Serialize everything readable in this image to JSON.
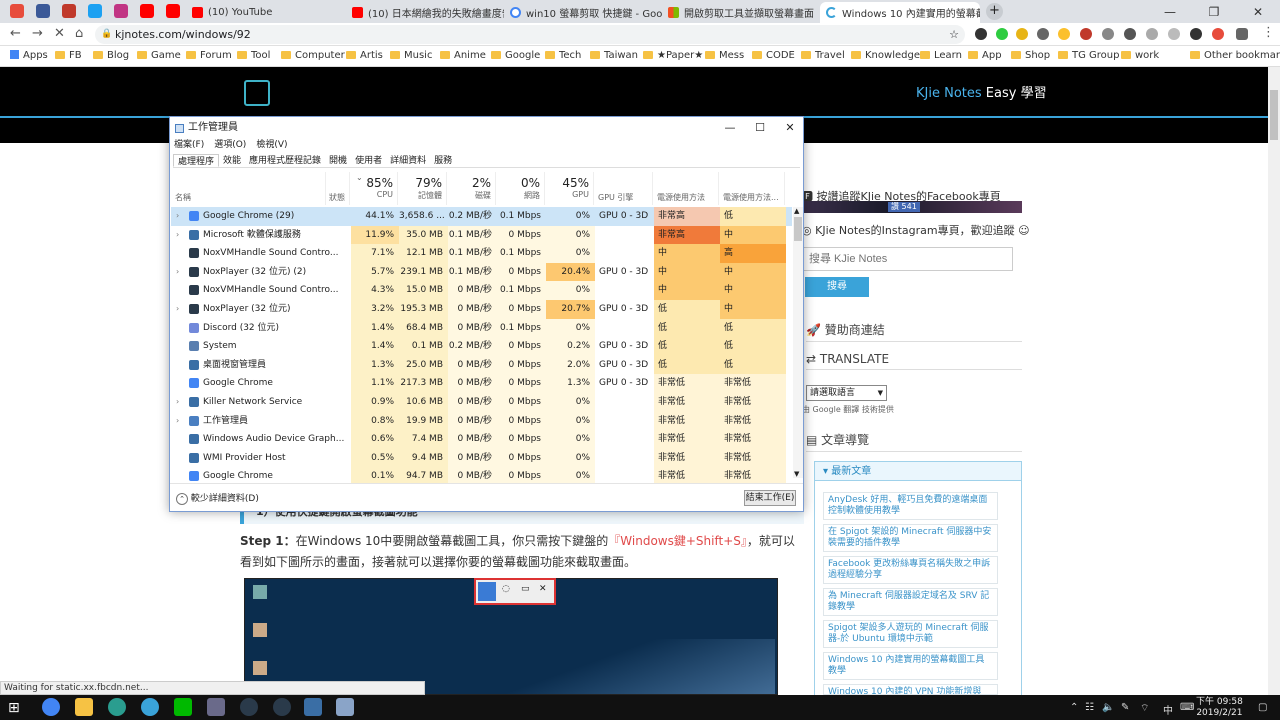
{
  "browser": {
    "tabs": [
      {
        "title": "(10) YouTube",
        "color": "#ff0000"
      },
      {
        "title": "(10) 日本網繪我的失敗繪畫度告訴...",
        "color": "#ff0000"
      },
      {
        "title": "win10 螢幕剪取 快捷鍵 - Google...",
        "color": "#4285f4"
      },
      {
        "title": "開啟剪取工具並擷取螢幕畫面",
        "color": "#f4b400"
      },
      {
        "title": "Windows 10 內建實用的螢幕截...",
        "color": "#3aa3d9"
      }
    ],
    "url": "kjnotes.com/windows/92",
    "bookmarks": [
      "Apps",
      "FB",
      "Blog",
      "Game",
      "Forum",
      "Tool",
      "Computer",
      "Artis",
      "Music",
      "Anime",
      "Google",
      "Tech",
      "Taiwan",
      "★Paper★",
      "Mess",
      "CODE",
      "Travel",
      "Knowledge",
      "Learn",
      "App",
      "Shop",
      "TG Group",
      "work",
      "Other bookmarks"
    ]
  },
  "site": {
    "title": "KJie Notes",
    "subtitle": "Easy 學習"
  },
  "article": {
    "heading": "1）使用快捷鍵開啟螢幕截圖功能",
    "step_label": "Step 1：",
    "step_text_a": "在Windows 10中要開啟螢幕截圖工具，你只需按下鍵盤的",
    "step_keys": "『Windows鍵+Shift+S』",
    "step_text_b": "，就可以看到如下圖所示的畫面，接著就可以選擇你要的螢幕截圖功能來截取畫面。"
  },
  "sidebar": {
    "fb_text": "按讚追蹤KJie Notes的Facebook專頁",
    "like_label": "讚 541",
    "ig_text": "KJie Notes的Instagram專頁，歡迎追蹤 ☺",
    "search_placeholder": "搜尋 KJie Notes",
    "search_button": "搜尋",
    "sponsor": "贊助商連結",
    "translate": "TRANSLATE",
    "lang_select": "請選取語言",
    "powered": "由 Google 翻譯 技術提供",
    "nav": "文章導覽",
    "latest": "最新文章",
    "posts": [
      "AnyDesk 好用、輕巧且免費的遠端桌面控制軟體使用教學",
      "在 Spigot 架設的 Minecraft 伺服器中安裝需要的插件教學",
      "Facebook 更改粉絲專頁名稱失敗之申訴過程經驗分享",
      "為 Minecraft 伺服器設定域名及 SRV 記錄教學",
      "Spigot 架設多人遊玩的 Minecraft 伺服器-於 Ubuntu 環境中示範",
      "Windows 10 內建實用的螢幕截圖工具教學",
      "Windows 10 內建的 VPN 功能新增與設..."
    ]
  },
  "taskmgr": {
    "title": "工作管理員",
    "menu": [
      "檔案(F)",
      "選項(O)",
      "檢視(V)"
    ],
    "tabs": [
      "處理程序",
      "效能",
      "應用程式歷程記錄",
      "開機",
      "使用者",
      "詳細資料",
      "服務"
    ],
    "headers": {
      "name": "名稱",
      "status": "狀態",
      "cpu_pct": "85%",
      "cpu": "CPU",
      "mem_pct": "79%",
      "mem": "記憶體",
      "disk_pct": "2%",
      "disk": "磁碟",
      "net_pct": "0%",
      "net": "網路",
      "gpu_pct": "45%",
      "gpu": "GPU",
      "gpu_engine": "GPU 引擎",
      "power": "電源使用方法",
      "power_trend": "電源使用方法..."
    },
    "rows": [
      {
        "name": "Google Chrome (29)",
        "expand": true,
        "icon": "#4285f4",
        "cpu": "44.1%",
        "mem": "3,658.6 ...",
        "disk": "0.2 MB/秒",
        "net": "0.1 Mbps",
        "gpu": "0%",
        "engine": "GPU 0 - 3D",
        "power": "非常高",
        "trend": "低",
        "pcol": "#f5c8b0",
        "tcol": "#fde9b0"
      },
      {
        "name": "Microsoft 軟體保護服務",
        "expand": true,
        "icon": "#3a6ea5",
        "cpu": "11.9%",
        "mem": "35.0 MB",
        "disk": "0.1 MB/秒",
        "net": "0 Mbps",
        "gpu": "0%",
        "engine": "",
        "power": "非常高",
        "trend": "中",
        "pcol": "#f07a3a",
        "tcol": "#fcc970"
      },
      {
        "name": "NoxVMHandle Sound Contro...",
        "expand": false,
        "icon": "#2a3a4a",
        "cpu": "7.1%",
        "mem": "12.1 MB",
        "disk": "0.1 MB/秒",
        "net": "0.1 Mbps",
        "gpu": "0%",
        "engine": "",
        "power": "中",
        "trend": "高",
        "pcol": "#fcc970",
        "tcol": "#f9a33a"
      },
      {
        "name": "NoxPlayer (32 位元) (2)",
        "expand": true,
        "icon": "#2a3a4a",
        "cpu": "5.7%",
        "mem": "239.1 MB",
        "disk": "0.1 MB/秒",
        "net": "0 Mbps",
        "gpu": "20.4%",
        "engine": "GPU 0 - 3D",
        "power": "中",
        "trend": "中",
        "pcol": "#fcc970",
        "tcol": "#fcc970"
      },
      {
        "name": "NoxVMHandle Sound Contro...",
        "expand": false,
        "icon": "#2a3a4a",
        "cpu": "4.3%",
        "mem": "15.0 MB",
        "disk": "0 MB/秒",
        "net": "0.1 Mbps",
        "gpu": "0%",
        "engine": "",
        "power": "中",
        "trend": "中",
        "pcol": "#fcc970",
        "tcol": "#fcc970"
      },
      {
        "name": "NoxPlayer (32 位元)",
        "expand": true,
        "icon": "#2a3a4a",
        "cpu": "3.2%",
        "mem": "195.3 MB",
        "disk": "0 MB/秒",
        "net": "0 Mbps",
        "gpu": "20.7%",
        "engine": "GPU 0 - 3D",
        "power": "低",
        "trend": "中",
        "pcol": "#fde9b0",
        "tcol": "#fcc970"
      },
      {
        "name": "Discord (32 位元)",
        "expand": false,
        "icon": "#7289da",
        "cpu": "1.4%",
        "mem": "68.4 MB",
        "disk": "0 MB/秒",
        "net": "0.1 Mbps",
        "gpu": "0%",
        "engine": "",
        "power": "低",
        "trend": "低",
        "pcol": "#fde9b0",
        "tcol": "#fde9b0"
      },
      {
        "name": "System",
        "expand": false,
        "icon": "#5a7fb0",
        "cpu": "1.4%",
        "mem": "0.1 MB",
        "disk": "0.2 MB/秒",
        "net": "0 Mbps",
        "gpu": "0.2%",
        "engine": "GPU 0 - 3D",
        "power": "低",
        "trend": "低",
        "pcol": "#fde9b0",
        "tcol": "#fde9b0"
      },
      {
        "name": "桌面視窗管理員",
        "expand": false,
        "icon": "#3a6ea5",
        "cpu": "1.3%",
        "mem": "25.0 MB",
        "disk": "0 MB/秒",
        "net": "0 Mbps",
        "gpu": "2.0%",
        "engine": "GPU 0 - 3D",
        "power": "低",
        "trend": "低",
        "pcol": "#fde9b0",
        "tcol": "#fde9b0"
      },
      {
        "name": "Google Chrome",
        "expand": false,
        "icon": "#4285f4",
        "cpu": "1.1%",
        "mem": "217.3 MB",
        "disk": "0 MB/秒",
        "net": "0 Mbps",
        "gpu": "1.3%",
        "engine": "GPU 0 - 3D",
        "power": "非常低",
        "trend": "非常低",
        "pcol": "#fff4d6",
        "tcol": "#fff4d6"
      },
      {
        "name": "Killer Network Service",
        "expand": true,
        "icon": "#3a6ea5",
        "cpu": "0.9%",
        "mem": "10.6 MB",
        "disk": "0 MB/秒",
        "net": "0 Mbps",
        "gpu": "0%",
        "engine": "",
        "power": "非常低",
        "trend": "非常低",
        "pcol": "#fff4d6",
        "tcol": "#fff4d6"
      },
      {
        "name": "工作管理員",
        "expand": true,
        "icon": "#4a7fc1",
        "cpu": "0.8%",
        "mem": "19.9 MB",
        "disk": "0 MB/秒",
        "net": "0 Mbps",
        "gpu": "0%",
        "engine": "",
        "power": "非常低",
        "trend": "非常低",
        "pcol": "#fff4d6",
        "tcol": "#fff4d6"
      },
      {
        "name": "Windows Audio Device Graph...",
        "expand": false,
        "icon": "#3a6ea5",
        "cpu": "0.6%",
        "mem": "7.4 MB",
        "disk": "0 MB/秒",
        "net": "0 Mbps",
        "gpu": "0%",
        "engine": "",
        "power": "非常低",
        "trend": "非常低",
        "pcol": "#fff4d6",
        "tcol": "#fff4d6"
      },
      {
        "name": "WMI Provider Host",
        "expand": false,
        "icon": "#3a6ea5",
        "cpu": "0.5%",
        "mem": "9.4 MB",
        "disk": "0 MB/秒",
        "net": "0 Mbps",
        "gpu": "0%",
        "engine": "",
        "power": "非常低",
        "trend": "非常低",
        "pcol": "#fff4d6",
        "tcol": "#fff4d6"
      },
      {
        "name": "Google Chrome",
        "expand": false,
        "icon": "#4285f4",
        "cpu": "0.1%",
        "mem": "94.7 MB",
        "disk": "0 MB/秒",
        "net": "0 Mbps",
        "gpu": "0%",
        "engine": "",
        "power": "非常低",
        "trend": "非常低",
        "pcol": "#fff4d6",
        "tcol": "#fff4d6"
      }
    ],
    "fewer_details": "較少詳細資料(D)",
    "end_task": "結束工作(E)"
  },
  "status_text": "Waiting for static.xx.fbcdn.net...",
  "clock": {
    "time": "下午 09:58",
    "date": "2019/2/21"
  },
  "tray_lang": "中"
}
